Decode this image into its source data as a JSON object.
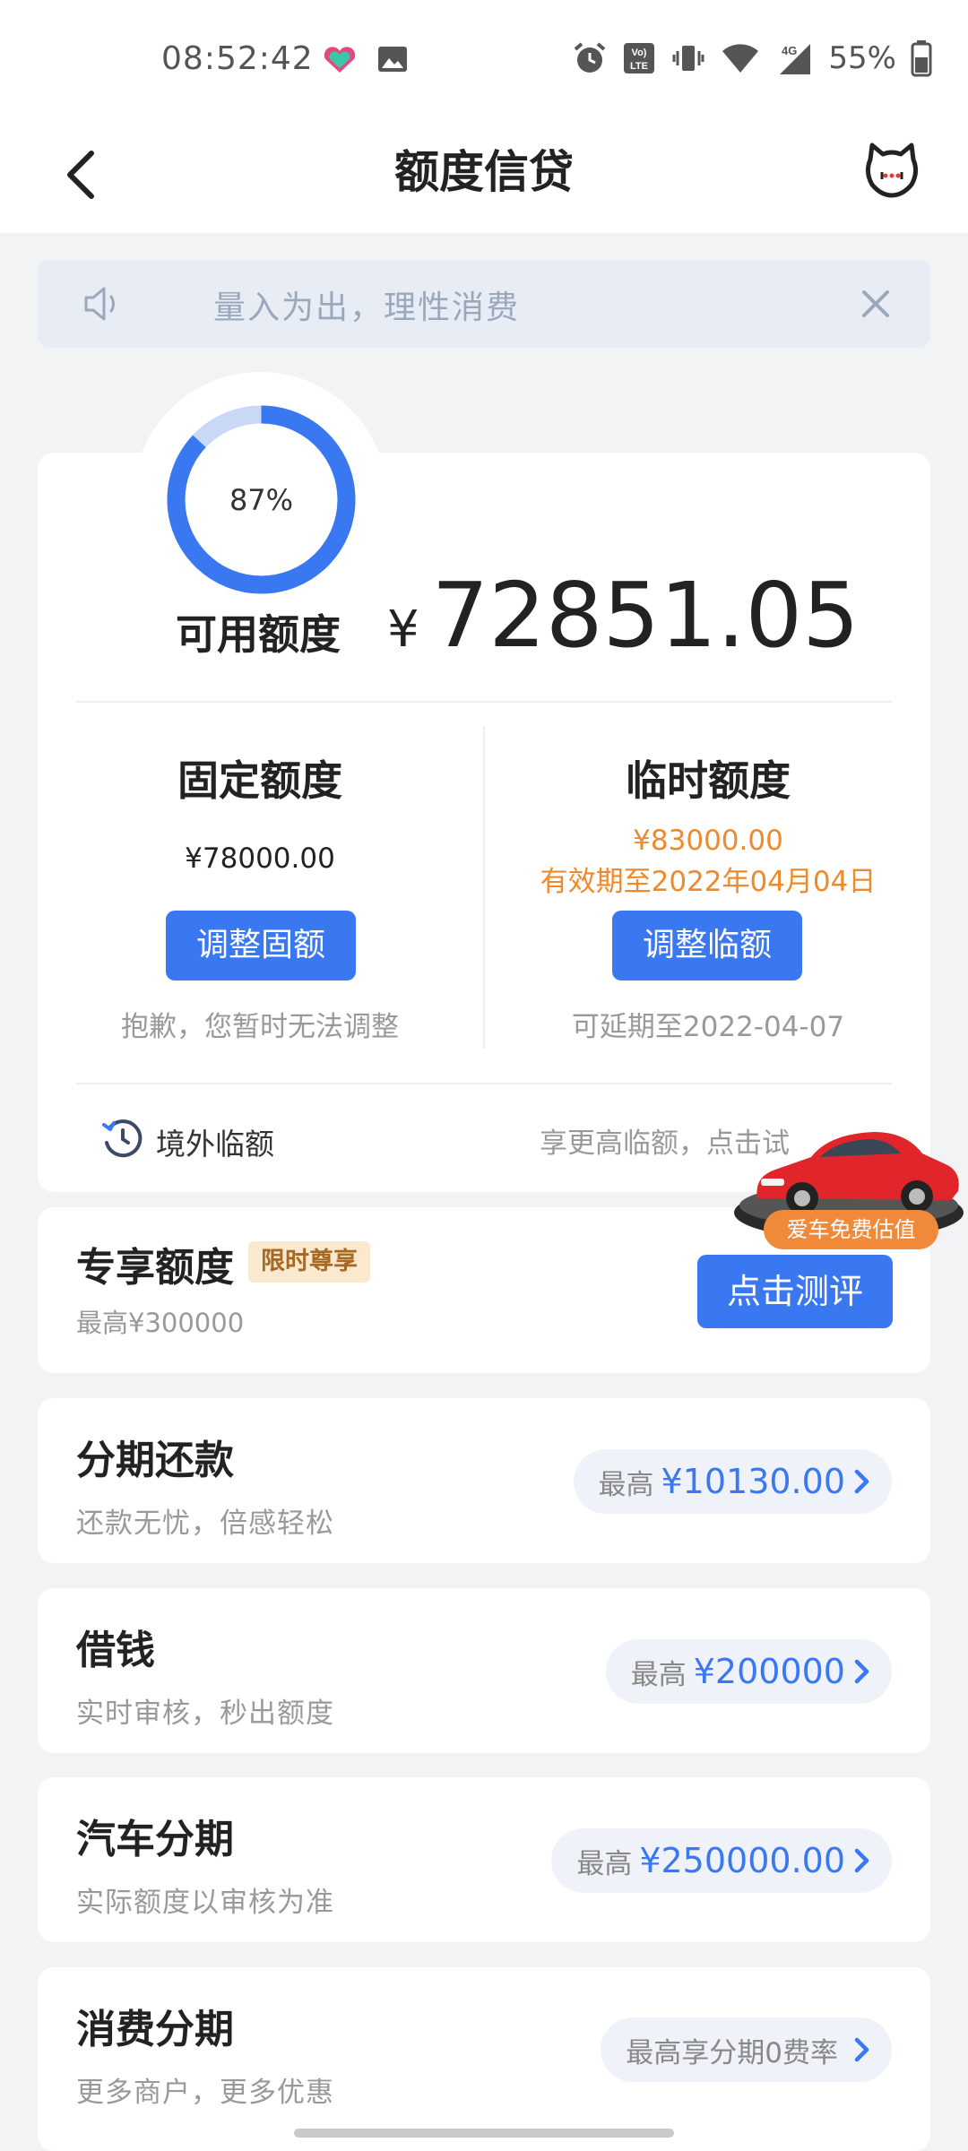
{
  "status_bar": {
    "time": "08:52:42",
    "battery": "55%"
  },
  "header": {
    "title": "额度信贷"
  },
  "notice": {
    "text": "量入为出，理性消费"
  },
  "credit": {
    "usage_percent": "87%",
    "usage_fraction": 0.87,
    "available_label": "可用额度",
    "currency": "¥",
    "available_amount": "72851.05"
  },
  "fixed": {
    "title": "固定额度",
    "amount": "¥78000.00",
    "button": "调整固额",
    "note": "抱歉，您暂时无法调整"
  },
  "temporary": {
    "title": "临时额度",
    "amount": "¥83000.00",
    "validity": "有效期至2022年04月04日",
    "button": "调整临额",
    "note": "可延期至2022-04-07"
  },
  "overseas": {
    "label": "境外临额",
    "right_text": "享更高临额，点击试"
  },
  "car_ad": {
    "label": "爱车免费估值"
  },
  "exclusive": {
    "title": "专享额度",
    "badge": "限时尊享",
    "sub": "最高¥300000",
    "button": "点击测评"
  },
  "items": [
    {
      "title": "分期还款",
      "sub": "还款无忧，倍感轻松",
      "pill_prefix": "最高",
      "pill_amount": "¥10130.00"
    },
    {
      "title": "借钱",
      "sub": "实时审核，秒出额度",
      "pill_prefix": "最高",
      "pill_amount": "¥200000"
    },
    {
      "title": "汽车分期",
      "sub": "实际额度以审核为准",
      "pill_prefix": "最高",
      "pill_amount": "¥250000.00"
    },
    {
      "title": "消费分期",
      "sub": "更多商户，更多优惠",
      "pill_prefix": "最高享分期0费率",
      "pill_amount": ""
    }
  ],
  "colors": {
    "primary": "#3a78f2",
    "orange": "#ef8a2c",
    "ring_track": "#c9d8f7"
  }
}
